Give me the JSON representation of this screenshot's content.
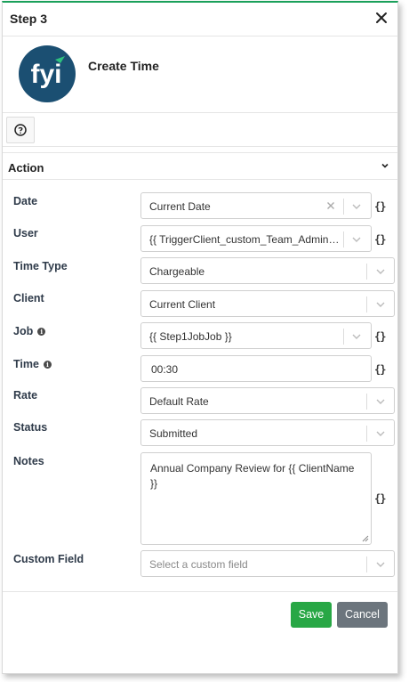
{
  "header": {
    "title": "Step 3"
  },
  "app": {
    "title": "Create Time",
    "logo_text": "fyi",
    "logo_color": "#1b4f72",
    "logo_accent": "#2ec27e"
  },
  "section": {
    "title": "Action"
  },
  "fields": {
    "date": {
      "label": "Date",
      "value": "Current Date"
    },
    "user": {
      "label": "User",
      "value": "{{ TriggerClient_custom_Team_Administrator }}"
    },
    "time_type": {
      "label": "Time Type",
      "value": "Chargeable"
    },
    "client": {
      "label": "Client",
      "value": "Current Client"
    },
    "job": {
      "label": "Job",
      "value": "{{ Step1JobJob }}"
    },
    "time": {
      "label": "Time",
      "value": "00:30"
    },
    "rate": {
      "label": "Rate",
      "value": "Default Rate"
    },
    "status": {
      "label": "Status",
      "value": "Submitted"
    },
    "notes": {
      "label": "Notes",
      "value": "Annual Company Review for {{ ClientName }}"
    },
    "custom_field": {
      "label": "Custom Field",
      "placeholder": "Select a custom field"
    }
  },
  "braces_glyph": "{}",
  "buttons": {
    "save": "Save",
    "cancel": "Cancel"
  },
  "colors": {
    "accent": "#28a745",
    "cancel": "#6c757d",
    "top_border": "#1aa05a"
  }
}
